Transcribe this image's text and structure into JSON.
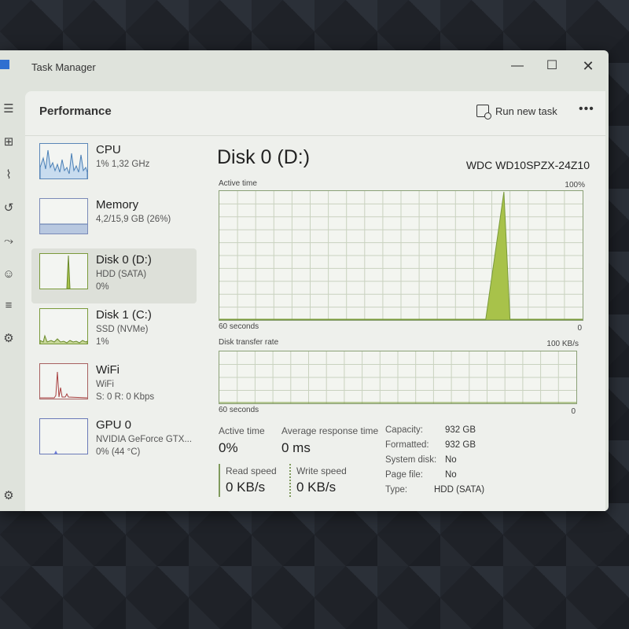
{
  "window": {
    "title": "Task Manager"
  },
  "header": {
    "title": "Performance",
    "run_new_task": "Run new task"
  },
  "devices": [
    {
      "name": "CPU",
      "sub": "1%  1,32 GHz",
      "sub2": ""
    },
    {
      "name": "Memory",
      "sub": "4,2/15,9 GB (26%)",
      "sub2": ""
    },
    {
      "name": "Disk 0 (D:)",
      "sub": "HDD (SATA)",
      "sub2": "0%"
    },
    {
      "name": "Disk 1 (C:)",
      "sub": "SSD (NVMe)",
      "sub2": "1%"
    },
    {
      "name": "WiFi",
      "sub": "WiFi",
      "sub2": "S: 0 R: 0 Kbps"
    },
    {
      "name": "GPU 0",
      "sub": "NVIDIA GeForce GTX...",
      "sub2": "0%  (44 °C)"
    }
  ],
  "detail": {
    "title": "Disk 0 (D:)",
    "model": "WDC WD10SPZX-24Z10",
    "active_chart": {
      "label": "Active time",
      "max": "100%",
      "span": "60 seconds",
      "min": "0"
    },
    "transfer_chart": {
      "label": "Disk transfer rate",
      "max": "100 KB/s",
      "span": "60 seconds",
      "min": "0"
    },
    "stats": {
      "active_time_label": "Active time",
      "active_time": "0%",
      "avg_response_label": "Average response time",
      "avg_response": "0 ms",
      "read_label": "Read speed",
      "read": "0 KB/s",
      "write_label": "Write speed",
      "write": "0 KB/s"
    },
    "properties": [
      {
        "label": "Capacity:",
        "value": "932 GB"
      },
      {
        "label": "Formatted:",
        "value": "932 GB"
      },
      {
        "label": "System disk:",
        "value": "No"
      },
      {
        "label": "Page file:",
        "value": "No"
      },
      {
        "label": "Type:",
        "value": "HDD (SATA)"
      }
    ]
  },
  "chart_data": {
    "type": "area",
    "title": "Active time",
    "x": [
      0,
      5,
      10,
      15,
      20,
      25,
      30,
      35,
      40,
      44,
      47,
      48,
      50,
      55,
      60
    ],
    "values": [
      0,
      0,
      0,
      0,
      0,
      0,
      0,
      0,
      0,
      0,
      100,
      0,
      0,
      0,
      0
    ],
    "ylim": [
      0,
      100
    ],
    "xlim": [
      0,
      60
    ],
    "grid": true,
    "colors": {
      "line": "#7a9a3a",
      "fill": "#a8c24a"
    }
  }
}
